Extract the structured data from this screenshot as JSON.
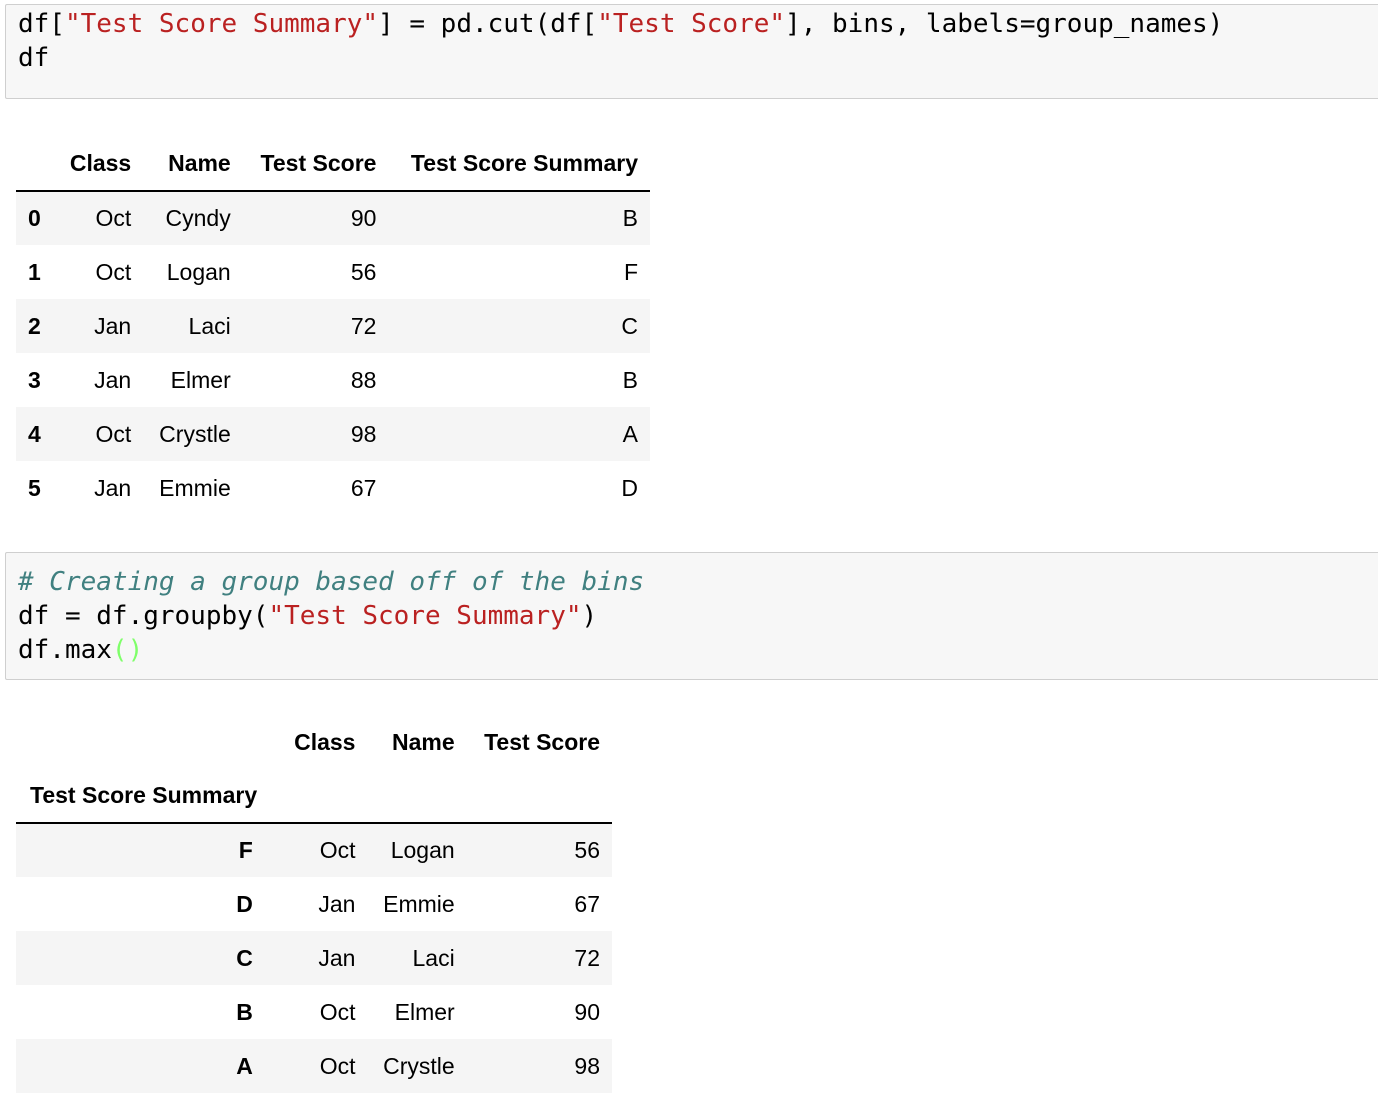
{
  "cell1": {
    "line1_prefix": "df[",
    "line1_str1": "\"Test Score Summary\"",
    "line1_mid": "] = pd.cut(df[",
    "line1_str2": "\"Test Score\"",
    "line1_suffix": "], bins, labels=group_names)",
    "line2": "df"
  },
  "table1": {
    "columns": [
      "Class",
      "Name",
      "Test Score",
      "Test Score Summary"
    ],
    "rows": [
      {
        "index": "0",
        "class": "Oct",
        "name": "Cyndy",
        "score": "90",
        "summary": "B"
      },
      {
        "index": "1",
        "class": "Oct",
        "name": "Logan",
        "score": "56",
        "summary": "F"
      },
      {
        "index": "2",
        "class": "Jan",
        "name": "Laci",
        "score": "72",
        "summary": "C"
      },
      {
        "index": "3",
        "class": "Jan",
        "name": "Elmer",
        "score": "88",
        "summary": "B"
      },
      {
        "index": "4",
        "class": "Oct",
        "name": "Crystle",
        "score": "98",
        "summary": "A"
      },
      {
        "index": "5",
        "class": "Jan",
        "name": "Emmie",
        "score": "67",
        "summary": "D"
      }
    ]
  },
  "cell2": {
    "comment": "# Creating a group based off of the bins",
    "line2_prefix": "df = df.groupby(",
    "line2_str": "\"Test Score Summary\"",
    "line2_suffix": ")",
    "line3_prefix": "df.max",
    "line3_parens": "()"
  },
  "table2": {
    "columns": [
      "Class",
      "Name",
      "Test Score"
    ],
    "index_name": "Test Score Summary",
    "rows": [
      {
        "index": "F",
        "class": "Oct",
        "name": "Logan",
        "score": "56"
      },
      {
        "index": "D",
        "class": "Jan",
        "name": "Emmie",
        "score": "67"
      },
      {
        "index": "C",
        "class": "Jan",
        "name": "Laci",
        "score": "72"
      },
      {
        "index": "B",
        "class": "Oct",
        "name": "Elmer",
        "score": "90"
      },
      {
        "index": "A",
        "class": "Oct",
        "name": "Crystle",
        "score": "98"
      }
    ]
  }
}
